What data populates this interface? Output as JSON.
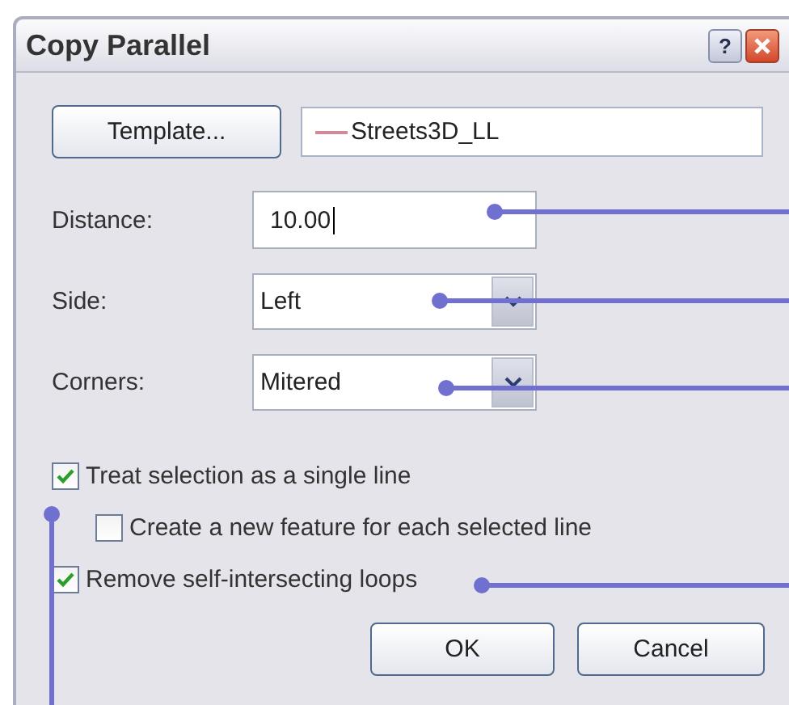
{
  "window": {
    "title": "Copy Parallel",
    "help_button": "?"
  },
  "template": {
    "button": "Template...",
    "value": "Streets3D_LL"
  },
  "fields": [
    {
      "kind": "text",
      "label": "Distance:",
      "value": "10.00"
    },
    {
      "kind": "combo",
      "label": "Side:",
      "value": "Left"
    },
    {
      "kind": "combo",
      "label": "Corners:",
      "value": "Mitered"
    }
  ],
  "options": [
    {
      "label": "Treat selection as a single line",
      "checked": true,
      "children": [
        {
          "label": "Create a new feature for each selected line",
          "checked": false
        }
      ]
    },
    {
      "label": "Remove self-intersecting loops",
      "checked": true
    }
  ],
  "buttons": [
    "OK",
    "Cancel"
  ]
}
